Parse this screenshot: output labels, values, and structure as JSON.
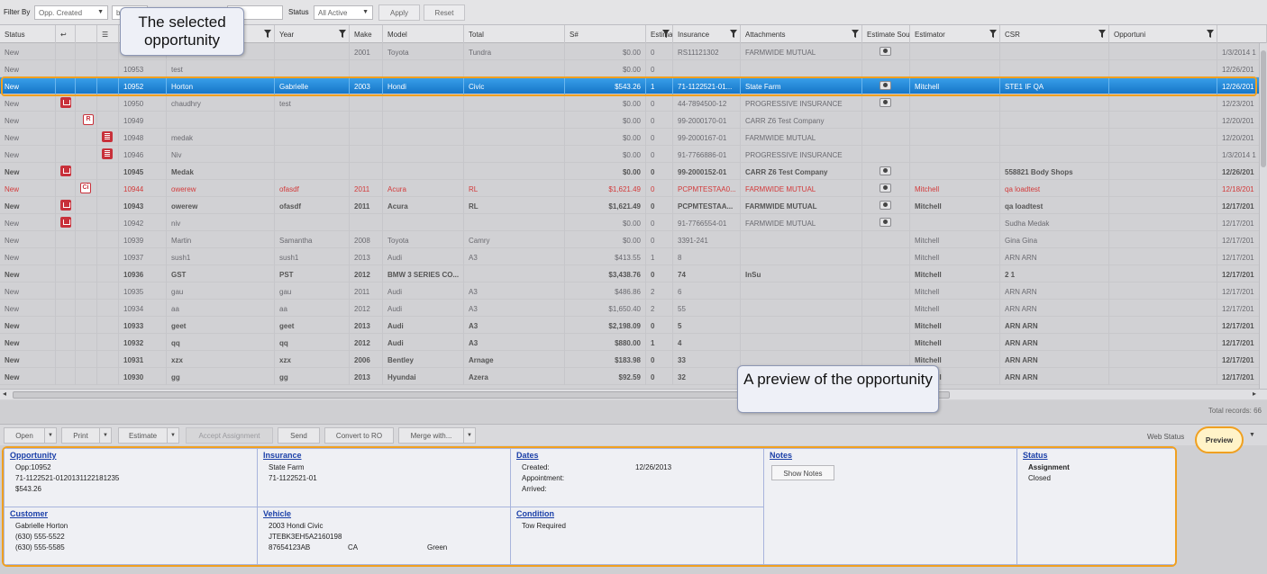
{
  "filter": {
    "filter_by_label": "Filter By",
    "filter_by_value": "Opp. Created",
    "date_from": "b",
    "date_to": "14",
    "status_label": "Status",
    "status_value": "All Active",
    "apply": "Apply",
    "reset": "Reset"
  },
  "columns": [
    "Status",
    "",
    "",
    "",
    "",
    "First",
    "Year",
    "Make",
    "Model",
    "Total",
    "S#",
    "Estimate #",
    "Insurance",
    "Attachments",
    "Estimate Source",
    "Estimator",
    "CSR",
    "Opportuni"
  ],
  "rows": [
    {
      "status": "New",
      "i1": "",
      "i2": "",
      "i3": "",
      "id": "",
      "last": "",
      "first": "",
      "year": "2001",
      "make": "Toyota",
      "model": "Tundra",
      "total": "$0.00",
      "s": "0",
      "est": "RS11121302",
      "ins": "FARMWIDE MUTUAL",
      "att": true,
      "src": "",
      "estimator": "",
      "csr": "",
      "opp": "1/3/2014 1",
      "style": ""
    },
    {
      "status": "New",
      "i1": "",
      "i2": "",
      "i3": "",
      "id": "10953",
      "last": "test",
      "first": "",
      "year": "",
      "make": "",
      "model": "",
      "total": "$0.00",
      "s": "0",
      "est": "",
      "ins": "",
      "att": false,
      "src": "",
      "estimator": "",
      "csr": "",
      "opp": "12/26/201",
      "style": ""
    },
    {
      "status": "New",
      "i1": "",
      "i2": "",
      "i3": "",
      "id": "10952",
      "last": "Horton",
      "first": "Gabrielle",
      "year": "2003",
      "make": "Hondi",
      "model": "Civic",
      "total": "$543.26",
      "s": "1",
      "est": "71-1122521-01...",
      "ins": "State Farm",
      "att": true,
      "src": "Mitchell",
      "estimator": "STE1 IF QA",
      "csr": "",
      "opp": "12/26/201",
      "style": "sel"
    },
    {
      "status": "New",
      "i1": "red",
      "i2": "",
      "i3": "",
      "id": "10950",
      "last": "chaudhry",
      "first": "test",
      "year": "",
      "make": "",
      "model": "",
      "total": "$0.00",
      "s": "0",
      "est": "44-7894500-12",
      "ins": "PROGRESSIVE INSURANCE",
      "att": true,
      "src": "",
      "estimator": "",
      "csr": "",
      "opp": "12/23/201",
      "style": ""
    },
    {
      "status": "New",
      "i1": "",
      "i2": "ro",
      "i3": "",
      "id": "10949",
      "last": "",
      "first": "",
      "year": "",
      "make": "",
      "model": "",
      "total": "$0.00",
      "s": "0",
      "est": "99-2000170-01",
      "ins": "CARR Z6 Test Company",
      "att": false,
      "src": "",
      "estimator": "",
      "csr": "",
      "opp": "12/20/201",
      "style": ""
    },
    {
      "status": "New",
      "i1": "",
      "i2": "",
      "i3": "doc",
      "id": "10948",
      "last": "medak",
      "first": "",
      "year": "",
      "make": "",
      "model": "",
      "total": "$0.00",
      "s": "0",
      "est": "99-2000167-01",
      "ins": "FARMWIDE MUTUAL",
      "att": false,
      "src": "",
      "estimator": "",
      "csr": "",
      "opp": "12/20/201",
      "style": ""
    },
    {
      "status": "New",
      "i1": "",
      "i2": "",
      "i3": "doc",
      "id": "10946",
      "last": "Niv",
      "first": "",
      "year": "",
      "make": "",
      "model": "",
      "total": "$0.00",
      "s": "0",
      "est": "91-7766886-01",
      "ins": "PROGRESSIVE INSURANCE",
      "att": false,
      "src": "",
      "estimator": "",
      "csr": "",
      "opp": "1/3/2014 1",
      "style": ""
    },
    {
      "status": "New",
      "i1": "red",
      "i2": "",
      "i3": "",
      "id": "10945",
      "last": "Medak",
      "first": "",
      "year": "",
      "make": "",
      "model": "",
      "total": "$0.00",
      "s": "0",
      "est": "99-2000152-01",
      "ins": "CARR Z6 Test Company",
      "att": true,
      "src": "",
      "estimator": "558821 Body Shops",
      "csr": "",
      "opp": "12/26/201",
      "style": "bold"
    },
    {
      "status": "New",
      "i1": "",
      "i2": "ci",
      "i3": "",
      "id": "10944",
      "last": "owerew",
      "first": "ofasdf",
      "year": "2011",
      "make": "Acura",
      "model": "RL",
      "total": "$1,621.49",
      "s": "0",
      "est": "PCPMTESTAA0...",
      "ins": "FARMWIDE MUTUAL",
      "att": true,
      "src": "Mitchell",
      "estimator": "qa loadtest",
      "csr": "",
      "opp": "12/18/201",
      "style": "red"
    },
    {
      "status": "New",
      "i1": "red",
      "i2": "",
      "i3": "",
      "id": "10943",
      "last": "owerew",
      "first": "ofasdf",
      "year": "2011",
      "make": "Acura",
      "model": "RL",
      "total": "$1,621.49",
      "s": "0",
      "est": "PCPMTESTAA...",
      "ins": "FARMWIDE MUTUAL",
      "att": true,
      "src": "Mitchell",
      "estimator": "qa loadtest",
      "csr": "",
      "opp": "12/17/201",
      "style": "bold"
    },
    {
      "status": "New",
      "i1": "red",
      "i2": "",
      "i3": "",
      "id": "10942",
      "last": "niv",
      "first": "",
      "year": "",
      "make": "",
      "model": "",
      "total": "$0.00",
      "s": "0",
      "est": "91-7766554-01",
      "ins": "FARMWIDE MUTUAL",
      "att": true,
      "src": "",
      "estimator": "Sudha Medak",
      "csr": "",
      "opp": "12/17/201",
      "style": ""
    },
    {
      "status": "New",
      "i1": "",
      "i2": "",
      "i3": "",
      "id": "10939",
      "last": "Martin",
      "first": "Samantha",
      "year": "2008",
      "make": "Toyota",
      "model": "Camry",
      "total": "$0.00",
      "s": "0",
      "est": "3391-241",
      "ins": "",
      "att": false,
      "src": "Mitchell",
      "estimator": "Gina Gina",
      "csr": "",
      "opp": "12/17/201",
      "style": ""
    },
    {
      "status": "New",
      "i1": "",
      "i2": "",
      "i3": "",
      "id": "10937",
      "last": "sush1",
      "first": "sush1",
      "year": "2013",
      "make": "Audi",
      "model": "A3",
      "total": "$413.55",
      "s": "1",
      "est": "8",
      "ins": "",
      "att": false,
      "src": "Mitchell",
      "estimator": "ARN ARN",
      "csr": "",
      "opp": "12/17/201",
      "style": ""
    },
    {
      "status": "New",
      "i1": "",
      "i2": "",
      "i3": "",
      "id": "10936",
      "last": "GST",
      "first": "PST",
      "year": "2012",
      "make": "BMW 3 SERIES CO...",
      "model": "",
      "total": "$3,438.76",
      "s": "0",
      "est": "74",
      "ins": "InSu",
      "att": false,
      "src": "Mitchell",
      "estimator": "2 1",
      "csr": "",
      "opp": "12/17/201",
      "style": "bold"
    },
    {
      "status": "New",
      "i1": "",
      "i2": "",
      "i3": "",
      "id": "10935",
      "last": "gau",
      "first": "gau",
      "year": "2011",
      "make": "Audi",
      "model": "A3",
      "total": "$486.86",
      "s": "2",
      "est": "6",
      "ins": "",
      "att": false,
      "src": "Mitchell",
      "estimator": "ARN ARN",
      "csr": "",
      "opp": "12/17/201",
      "style": ""
    },
    {
      "status": "New",
      "i1": "",
      "i2": "",
      "i3": "",
      "id": "10934",
      "last": "aa",
      "first": "aa",
      "year": "2012",
      "make": "Audi",
      "model": "A3",
      "total": "$1,650.40",
      "s": "2",
      "est": "55",
      "ins": "",
      "att": false,
      "src": "Mitchell",
      "estimator": "ARN ARN",
      "csr": "",
      "opp": "12/17/201",
      "style": ""
    },
    {
      "status": "New",
      "i1": "",
      "i2": "",
      "i3": "",
      "id": "10933",
      "last": "geet",
      "first": "geet",
      "year": "2013",
      "make": "Audi",
      "model": "A3",
      "total": "$2,198.09",
      "s": "0",
      "est": "5",
      "ins": "",
      "att": false,
      "src": "Mitchell",
      "estimator": "ARN ARN",
      "csr": "",
      "opp": "12/17/201",
      "style": "bold"
    },
    {
      "status": "New",
      "i1": "",
      "i2": "",
      "i3": "",
      "id": "10932",
      "last": "qq",
      "first": "qq",
      "year": "2012",
      "make": "Audi",
      "model": "A3",
      "total": "$880.00",
      "s": "1",
      "est": "4",
      "ins": "",
      "att": false,
      "src": "Mitchell",
      "estimator": "ARN ARN",
      "csr": "",
      "opp": "12/17/201",
      "style": "bold"
    },
    {
      "status": "New",
      "i1": "",
      "i2": "",
      "i3": "",
      "id": "10931",
      "last": "xzx",
      "first": "xzx",
      "year": "2006",
      "make": "Bentley",
      "model": "Arnage",
      "total": "$183.98",
      "s": "0",
      "est": "33",
      "ins": "",
      "att": false,
      "src": "Mitchell",
      "estimator": "ARN ARN",
      "csr": "",
      "opp": "12/17/201",
      "style": "bold"
    },
    {
      "status": "New",
      "i1": "",
      "i2": "",
      "i3": "",
      "id": "10930",
      "last": "gg",
      "first": "gg",
      "year": "2013",
      "make": "Hyundai",
      "model": "Azera",
      "total": "$92.59",
      "s": "0",
      "est": "32",
      "ins": "",
      "att": false,
      "src": "Mitchell",
      "estimator": "ARN ARN",
      "csr": "",
      "opp": "12/17/201",
      "style": "bold"
    }
  ],
  "total_records": "Total records: 66",
  "actions": {
    "open": "Open",
    "print": "Print",
    "estimate": "Estimate",
    "accept_assignment": "Accept Assignment",
    "send": "Send",
    "convert_to_ro": "Convert to RO",
    "merge_with": "Merge with...",
    "web_status": "Web Status",
    "preview": "Preview"
  },
  "preview": {
    "opportunity": {
      "title": "Opportunity",
      "lines": [
        "Opp:10952",
        "71-1122521-0120131122181235",
        "$543.26"
      ]
    },
    "insurance": {
      "title": "Insurance",
      "lines": [
        "State Farm",
        "71-1122521-01"
      ]
    },
    "dates": {
      "title": "Dates",
      "created_label": "Created:",
      "created_value": "12/26/2013",
      "appointment_label": "Appointment:",
      "arrived_label": "Arrived:"
    },
    "notes": {
      "title": "Notes",
      "show_notes": "Show Notes"
    },
    "status": {
      "title": "Status",
      "lines": [
        "Assignment",
        "Closed"
      ]
    },
    "customer": {
      "title": "Customer",
      "lines": [
        "Gabrielle Horton",
        "(630) 555-5522",
        "(630) 555-5585"
      ]
    },
    "vehicle": {
      "title": "Vehicle",
      "line1": "2003 Hondi Civic",
      "line2": "JTEBK3EH5A2160198",
      "plate": "87654123AB",
      "state": "CA",
      "color": "Green"
    },
    "condition": {
      "title": "Condition",
      "lines": [
        "Tow Required"
      ]
    }
  },
  "callouts": {
    "selected": "The selected opportunity",
    "preview": "A preview of the opportunity"
  }
}
